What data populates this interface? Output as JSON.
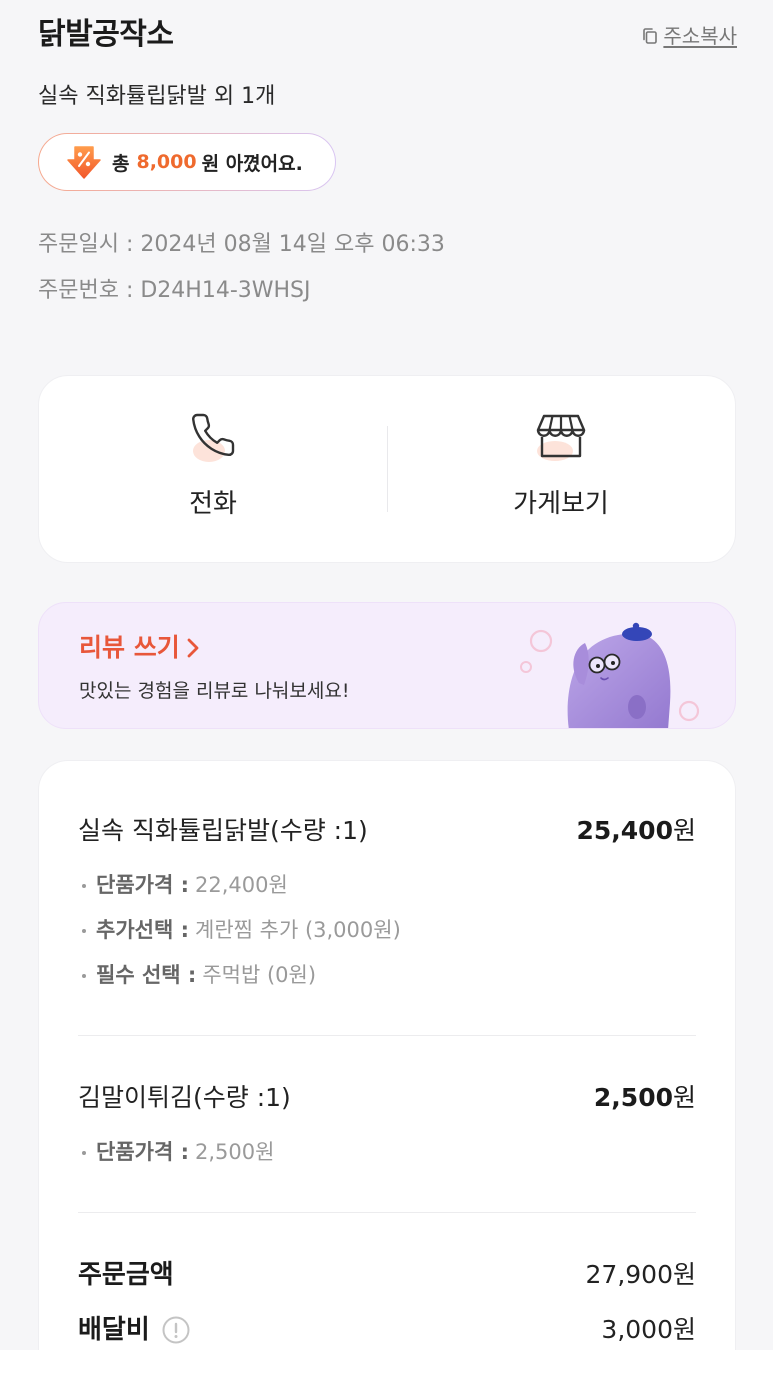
{
  "store": {
    "name": "닭발공작소",
    "copy_address_label": "주소복사",
    "copy_icon": "copy-icon"
  },
  "order_summary": "실속 직화튤립닭발 외 1개",
  "savings": {
    "icon": "discount-arrow-icon",
    "prefix": "총",
    "amount": "8,000",
    "suffix": "원 아꼈어요."
  },
  "order_info": {
    "date_line": "주문일시 : 2024년 08월 14일 오후 06:33",
    "number_line": "주문번호 : D24H14-3WHSJ"
  },
  "actions": [
    {
      "label": "전화",
      "icon": "phone-icon"
    },
    {
      "label": "가게보기",
      "icon": "store-icon"
    }
  ],
  "review_banner": {
    "title": "리뷰 쓰기",
    "title_icon": "chevron-right-icon",
    "subtitle": "맛있는 경험을 리뷰로 나눠보세요!",
    "illustration": "mascot-character-icon"
  },
  "items": [
    {
      "name": "실속 직화튤립닭발(수량 :1)",
      "price_value": "25,400",
      "price_unit": "원",
      "options": [
        {
          "label": "단품가격 :",
          "value": "22,400원"
        },
        {
          "label": "추가선택 :",
          "value": "계란찜 추가 (3,000원)"
        },
        {
          "label": "필수 선택 :",
          "value": "주먹밥 (0원)"
        }
      ]
    },
    {
      "name": "김말이튀김(수량 :1)",
      "price_value": "2,500",
      "price_unit": "원",
      "options": [
        {
          "label": "단품가격 :",
          "value": "2,500원"
        }
      ]
    }
  ],
  "totals": [
    {
      "label": "주문금액",
      "amount": "27,900원"
    },
    {
      "label": "배달비",
      "amount": "3,000원",
      "icon": "info-icon"
    }
  ],
  "colors": {
    "background": "#f6f6f8",
    "accent": "#e8573a",
    "savings_amount": "#ef6a2e",
    "review_background": "#f5edfc",
    "muted_text": "#8a8a8a",
    "card": "#ffffff"
  }
}
